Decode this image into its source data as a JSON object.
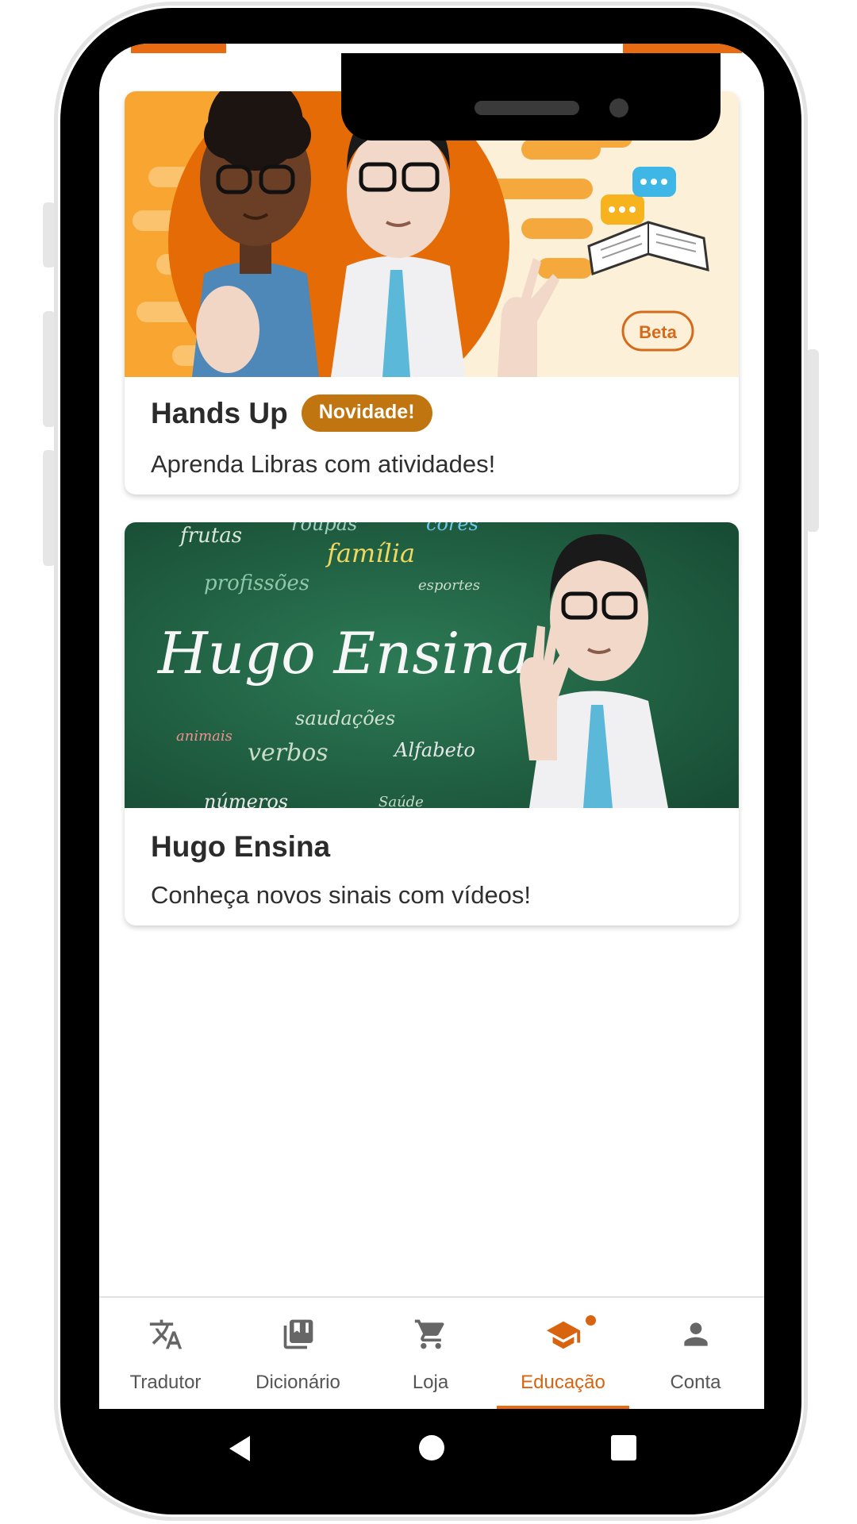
{
  "cards": [
    {
      "title": "Hands Up",
      "badge": "Novidade!",
      "subtitle": "Aprenda Libras com atividades!",
      "banner_badge": "Beta"
    },
    {
      "title": "Hugo Ensina",
      "subtitle": "Conheça novos sinais com vídeos!",
      "banner": {
        "headline": "Hugo Ensina",
        "words": [
          "frutas",
          "roupas",
          "família",
          "cores",
          "profissões",
          "esportes",
          "saudações",
          "animais",
          "verbos",
          "Alfabeto",
          "números",
          "Saúde"
        ]
      }
    }
  ],
  "bottom_nav": {
    "items": [
      {
        "label": "Tradutor",
        "icon": "translate-icon"
      },
      {
        "label": "Dicionário",
        "icon": "library-books-icon"
      },
      {
        "label": "Loja",
        "icon": "shopping-cart-icon"
      },
      {
        "label": "Educação",
        "icon": "graduation-cap-icon",
        "active": true
      },
      {
        "label": "Conta",
        "icon": "person-icon"
      }
    ]
  },
  "colors": {
    "accent": "#e86a12",
    "badge": "#c07510",
    "chalkboard": "#1f5d43"
  }
}
